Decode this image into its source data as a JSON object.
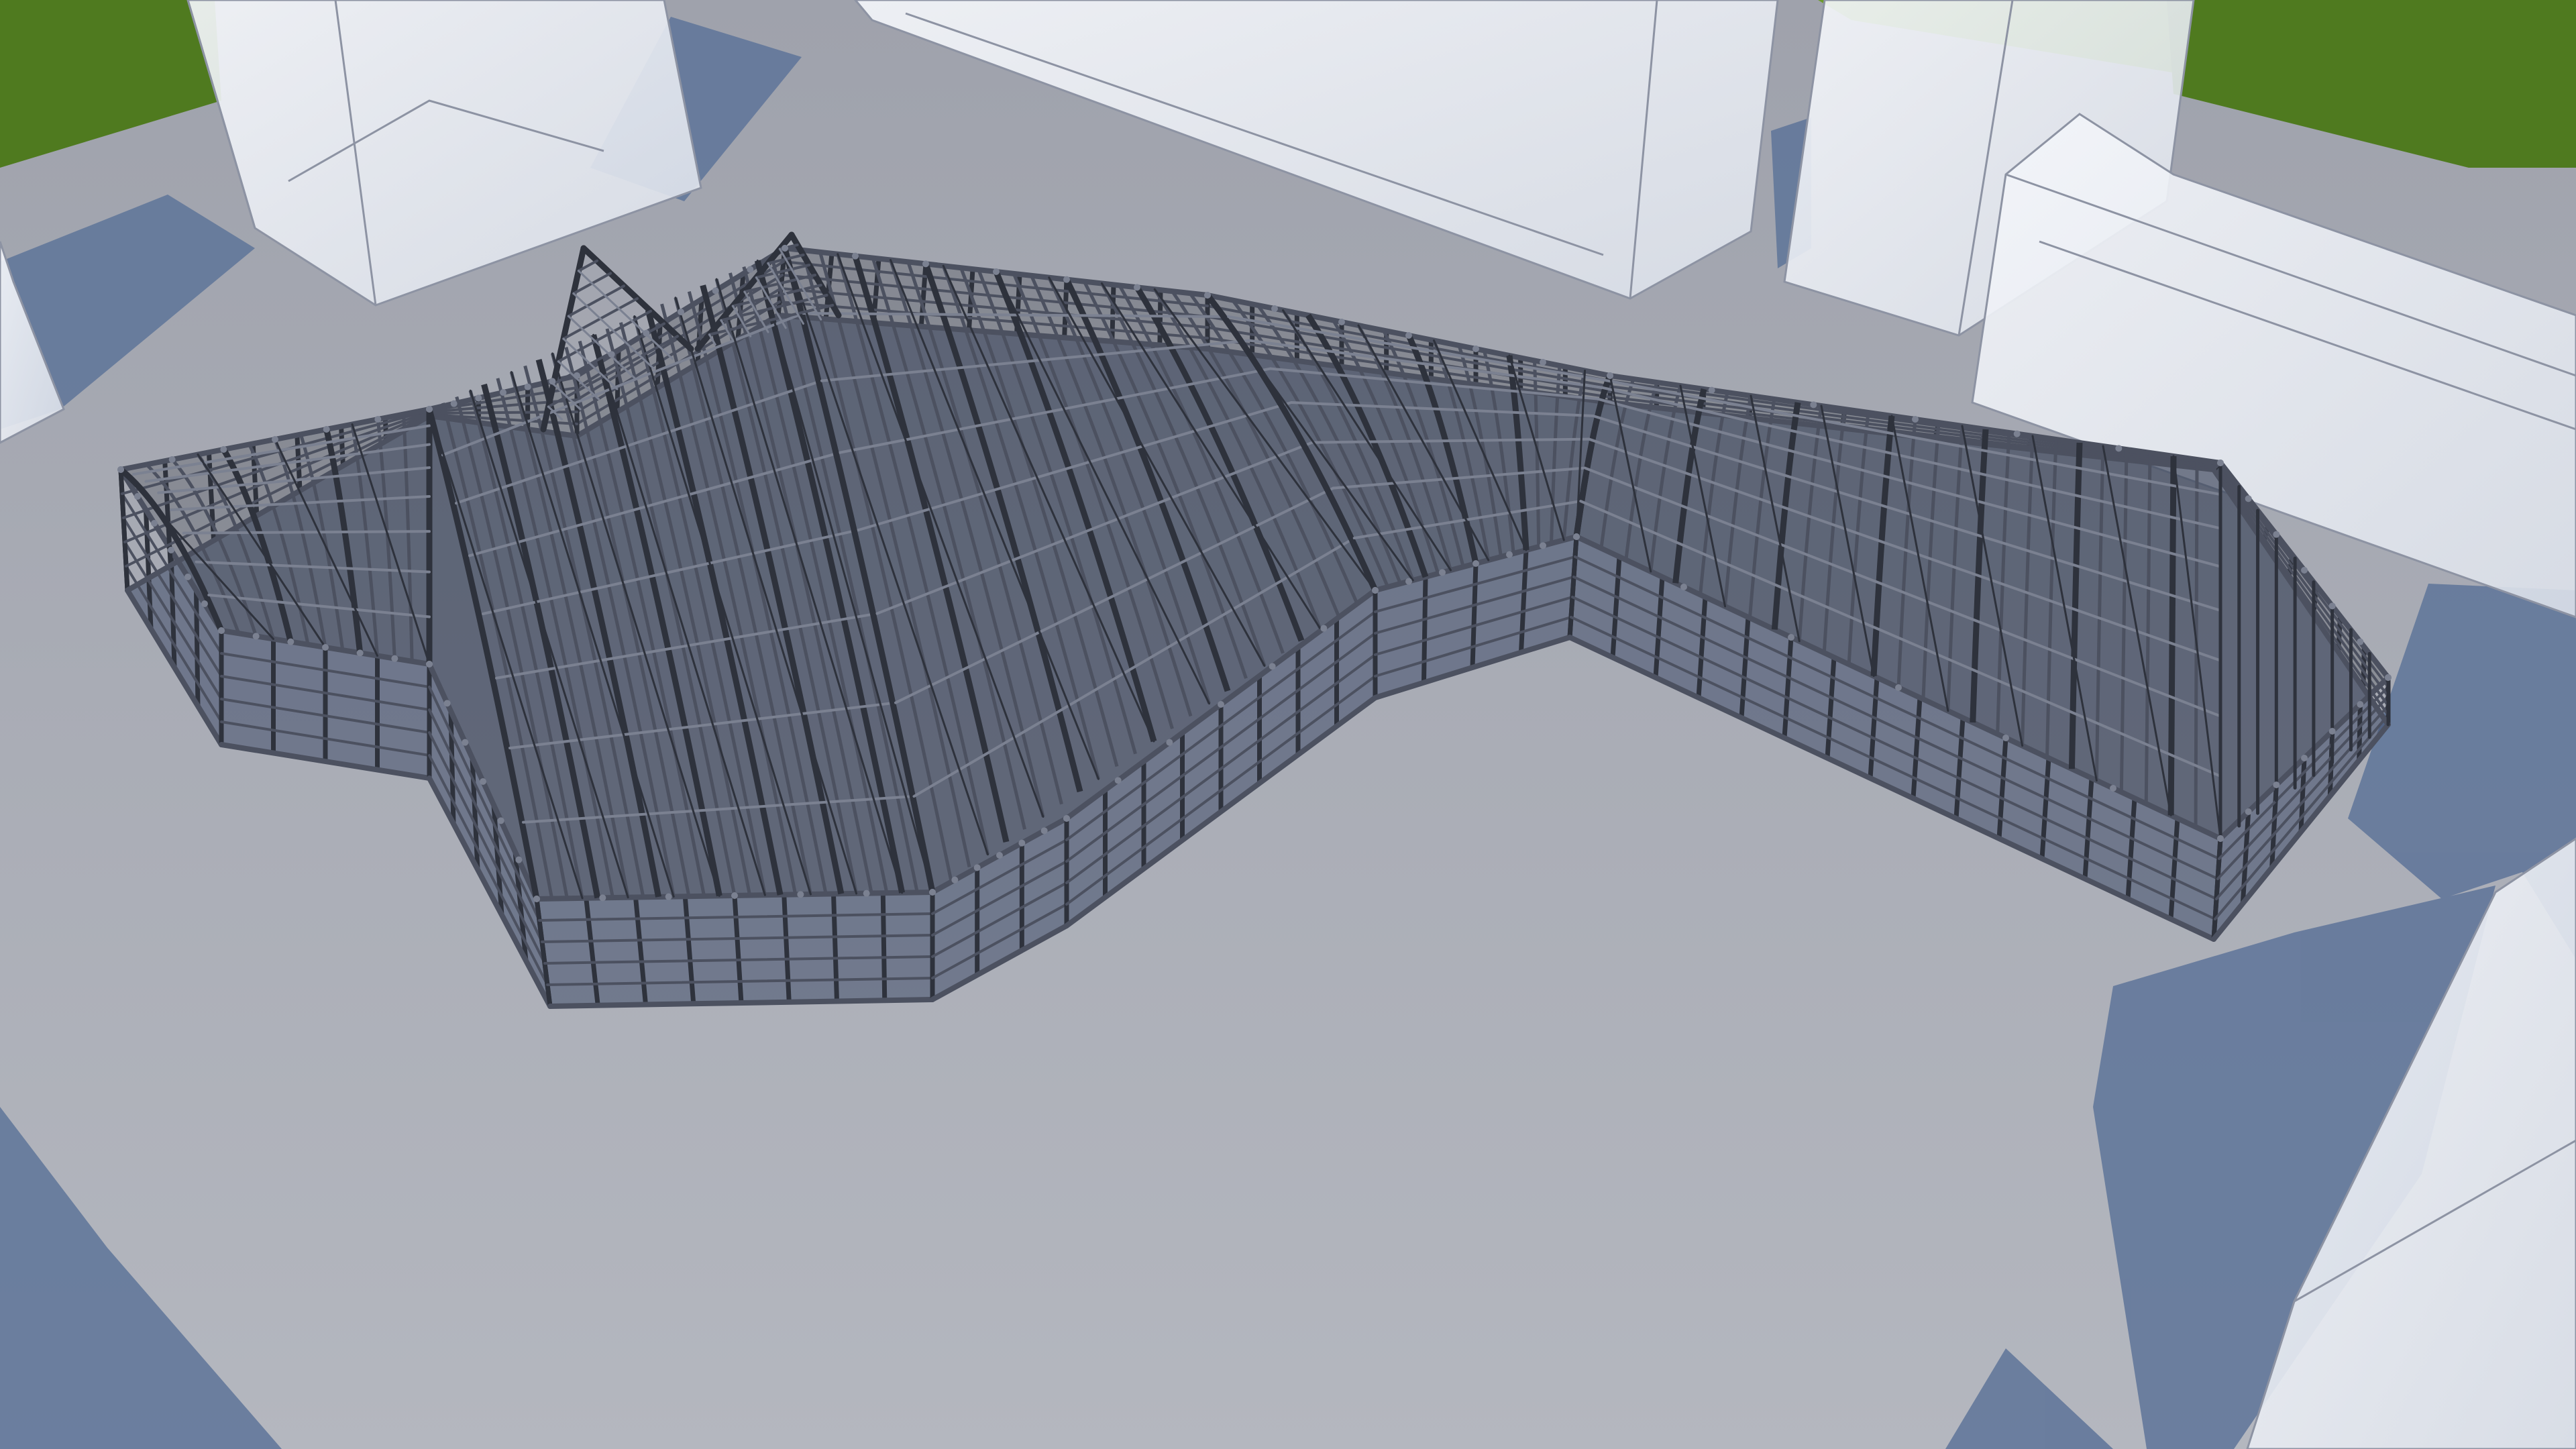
{
  "scene": {
    "kind": "architectural-render",
    "subject": "steel-frame-structure",
    "colors": {
      "ground_top": "#9fa2ac",
      "ground_bottom": "#b4b7bf",
      "grass": "#4f7a1f",
      "grass_light": "#6c9a2d",
      "massing_fill": "#e7eaf1",
      "massing_edge": "#8d93a3",
      "shadow": "#5e7499",
      "steel": "#4c5160",
      "steel_dark": "#2e323c",
      "steel_light": "#7b8191",
      "interior_shadow": "#3f4d6a"
    }
  }
}
